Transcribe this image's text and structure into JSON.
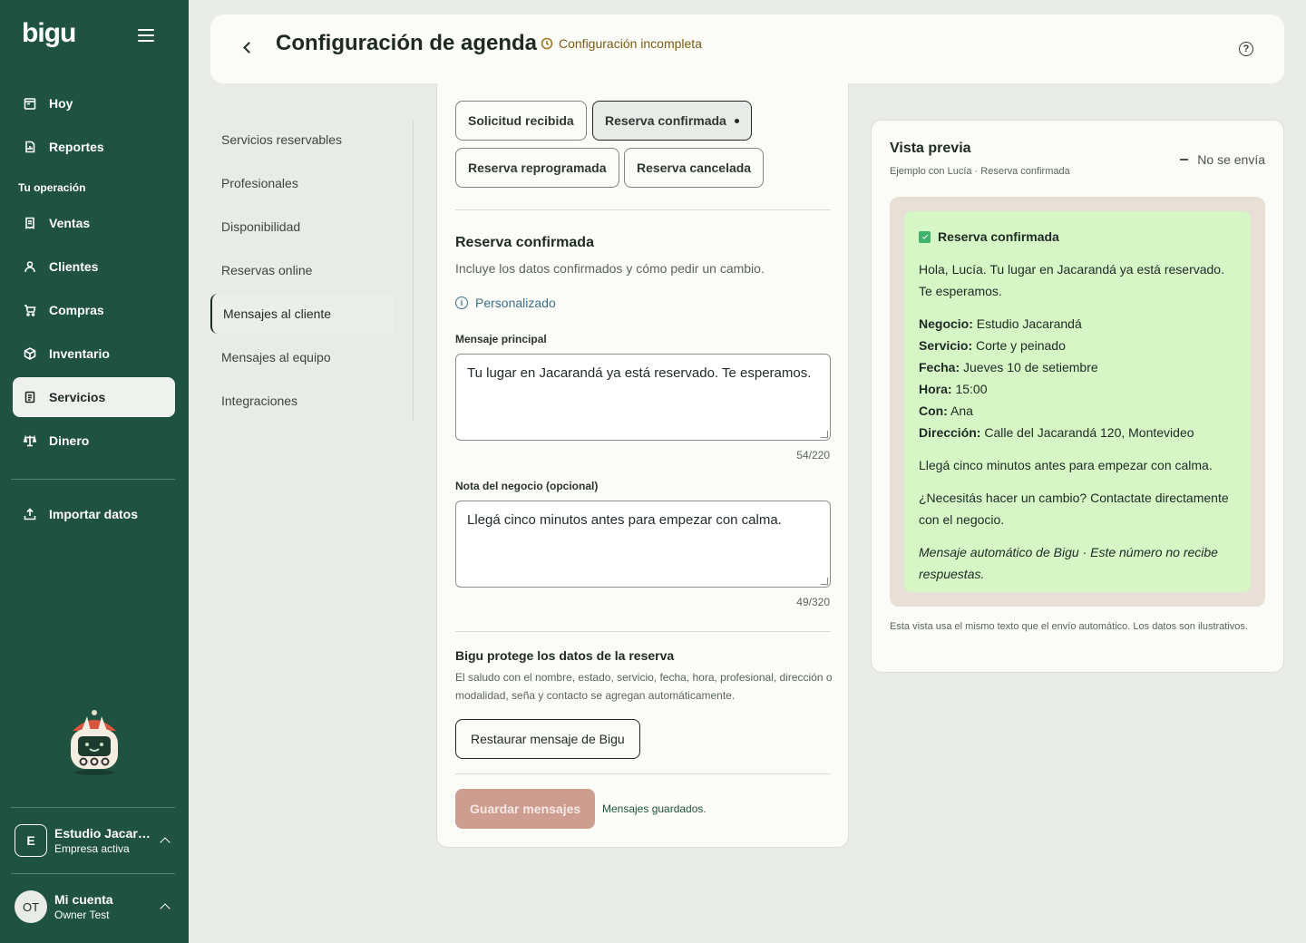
{
  "app": {
    "logo": "bigu"
  },
  "sidebar": {
    "top_items": [
      {
        "label": "Hoy"
      },
      {
        "label": "Reportes"
      }
    ],
    "section_label": "Tu operación",
    "items": [
      {
        "label": "Ventas"
      },
      {
        "label": "Clientes"
      },
      {
        "label": "Compras"
      },
      {
        "label": "Inventario"
      },
      {
        "label": "Servicios"
      },
      {
        "label": "Dinero"
      }
    ],
    "import_label": "Importar datos",
    "company": {
      "initial": "E",
      "name": "Estudio Jacara...",
      "status": "Empresa activa"
    },
    "account": {
      "initials": "OT",
      "name": "Mi cuenta",
      "user": "Owner Test"
    }
  },
  "header": {
    "title": "Configuración de agenda",
    "status": "Configuración incompleta",
    "help_icon": "?"
  },
  "subnav": {
    "items": [
      {
        "label": "Servicios reservables"
      },
      {
        "label": "Profesionales"
      },
      {
        "label": "Disponibilidad"
      },
      {
        "label": "Reservas online"
      },
      {
        "label": "Mensajes al cliente"
      },
      {
        "label": "Mensajes al equipo"
      },
      {
        "label": "Integraciones"
      }
    ]
  },
  "editor": {
    "chips": [
      {
        "label": "Solicitud recibida"
      },
      {
        "label": "Reserva confirmada"
      },
      {
        "label": "Reserva reprogramada"
      },
      {
        "label": "Reserva cancelada"
      }
    ],
    "section_title": "Reserva confirmada",
    "section_desc": "Incluye los datos confirmados y cómo pedir un cambio.",
    "custom_label": "Personalizado",
    "main_message_label": "Mensaje principal",
    "main_message_value": "Tu lugar en Jacarandá ya está reservado. Te esperamos.",
    "main_message_count": "54/220",
    "note_label": "Nota del negocio (opcional)",
    "note_value": "Llegá cinco minutos antes para empezar con calma.",
    "note_count": "49/320",
    "protect_title": "Bigu protege los datos de la reserva",
    "protect_desc": "El saludo con el nombre, estado, servicio, fecha, hora, profesional, dirección o modalidad, seña y contacto se agregan automáticamente.",
    "restore_label": "Restaurar mensaje de Bigu",
    "save_label": "Guardar mensajes",
    "saved_text": "Mensajes guardados."
  },
  "preview": {
    "title": "Vista previa",
    "subtitle": "Ejemplo con Lucía · Reserva confirmada",
    "no_send": "No se envía",
    "bubble": {
      "header": "Reserva confirmada",
      "greeting": "Hola, Lucía. Tu lugar en Jacarandá ya está reservado. Te esperamos.",
      "fields": [
        {
          "k": "Negocio:",
          "v": "Estudio Jacarandá"
        },
        {
          "k": "Servicio:",
          "v": "Corte y peinado"
        },
        {
          "k": "Fecha:",
          "v": "Jueves 10 de setiembre"
        },
        {
          "k": "Hora:",
          "v": "15:00"
        },
        {
          "k": "Con:",
          "v": "Ana"
        },
        {
          "k": "Dirección:",
          "v": "Calle del Jacarandá 120, Montevideo"
        }
      ],
      "note": "Llegá cinco minutos antes para empezar con calma.",
      "change": "¿Necesitás hacer un cambio? Contactate directamente con el negocio.",
      "footer": "Mensaje automático de Bigu · Este número no recibe respuestas."
    },
    "note": "Esta vista usa el mismo texto que el envío automático. Los datos son ilustrativos."
  },
  "colors": {
    "sidebar_bg": "#1f5240",
    "accent_save": "#cd9d90",
    "bubble_bg": "#d6f6c6",
    "status_text": "#7a5c12"
  }
}
